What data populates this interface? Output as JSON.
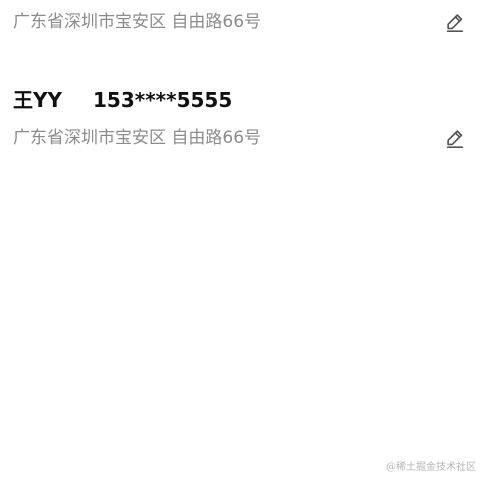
{
  "entries": [
    {
      "address": "广东省深圳市宝安区 自由路66号",
      "edit_icon": "pencil-icon"
    },
    {
      "name": "王YY",
      "phone": "153****5555",
      "address": "广东省深圳市宝安区 自由路66号",
      "edit_icon": "pencil-icon"
    }
  ],
  "watermark": "@稀土掘金技术社区",
  "colors": {
    "address_text": "#8c8c8c",
    "name_text": "#111111",
    "icon": "#555555",
    "background": "#ffffff"
  }
}
